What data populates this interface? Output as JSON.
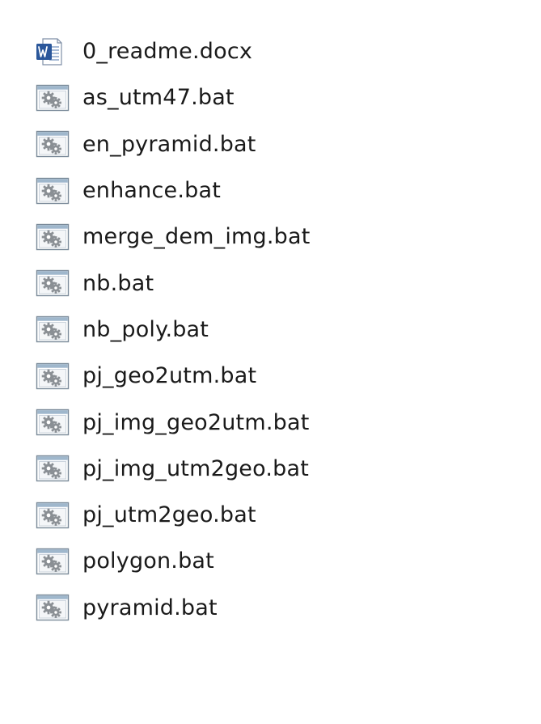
{
  "files": [
    {
      "name": "0_readme.docx",
      "icon": "word-document-icon"
    },
    {
      "name": "as_utm47.bat",
      "icon": "batch-file-icon"
    },
    {
      "name": "en_pyramid.bat",
      "icon": "batch-file-icon"
    },
    {
      "name": "enhance.bat",
      "icon": "batch-file-icon"
    },
    {
      "name": "merge_dem_img.bat",
      "icon": "batch-file-icon"
    },
    {
      "name": "nb.bat",
      "icon": "batch-file-icon"
    },
    {
      "name": "nb_poly.bat",
      "icon": "batch-file-icon"
    },
    {
      "name": "pj_geo2utm.bat",
      "icon": "batch-file-icon"
    },
    {
      "name": "pj_img_geo2utm.bat",
      "icon": "batch-file-icon"
    },
    {
      "name": "pj_img_utm2geo.bat",
      "icon": "batch-file-icon"
    },
    {
      "name": "pj_utm2geo.bat",
      "icon": "batch-file-icon"
    },
    {
      "name": "polygon.bat",
      "icon": "batch-file-icon"
    },
    {
      "name": "pyramid.bat",
      "icon": "batch-file-icon"
    }
  ],
  "colors": {
    "word_blue": "#2b579a",
    "window_frame": "#7a8a99",
    "window_title": "#9fb7cc",
    "gear": "#8a8f94"
  }
}
